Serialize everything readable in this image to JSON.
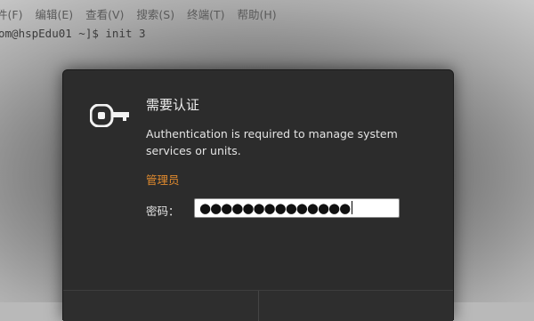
{
  "menubar": {
    "items": [
      "件(F)",
      "编辑(E)",
      "查看(V)",
      "搜索(S)",
      "终端(T)",
      "帮助(H)"
    ]
  },
  "terminal": {
    "line": "om@hspEdu01 ~]$ init 3"
  },
  "dialog": {
    "title": "需要认证",
    "message": "Authentication is required to manage system services or units.",
    "user": "管理员",
    "password_label": "密码：",
    "password_value": "●●●●●●●●●●●●●●",
    "buttons": [
      "",
      ""
    ],
    "accent_color": "#e08a2e",
    "icon": "key-icon"
  }
}
